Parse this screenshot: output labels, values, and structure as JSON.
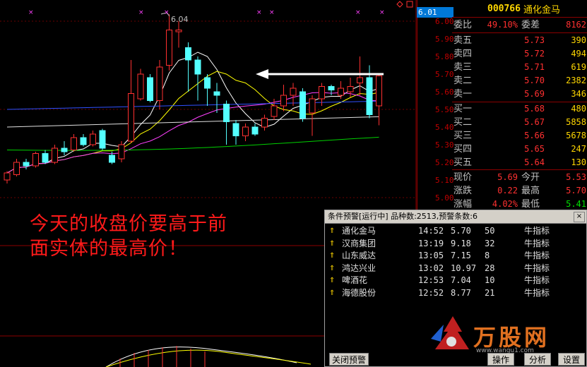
{
  "chart": {
    "high_label": "6.04",
    "current_price_box": "6.01",
    "price_ticks": [
      "6.00",
      "5.90",
      "5.80",
      "5.70",
      "5.60",
      "5.50",
      "5.40",
      "5.30",
      "5.20",
      "5.10",
      "5.00"
    ],
    "colors": {
      "up": "#ff3030",
      "down": "#54ffff",
      "ma5": "#ffffff",
      "ma10": "#ffff00",
      "ma20": "#ff40ff",
      "ma60": "#00d000",
      "ma_blue": "#3050ff"
    }
  },
  "annotation": {
    "line1": "今天的收盘价要高于前",
    "line2": "面实体的最高价！"
  },
  "quote": {
    "code": "000766",
    "name": "通化金马",
    "weibi_label": "委比",
    "weibi_value": "49.10%",
    "weicha_label": "委差",
    "weicha_value": "8162",
    "sell": [
      {
        "label": "卖五",
        "price": "5.73",
        "vol": "390"
      },
      {
        "label": "卖四",
        "price": "5.72",
        "vol": "494"
      },
      {
        "label": "卖三",
        "price": "5.71",
        "vol": "619"
      },
      {
        "label": "卖二",
        "price": "5.70",
        "vol": "2382"
      },
      {
        "label": "卖一",
        "price": "5.69",
        "vol": "346"
      }
    ],
    "buy": [
      {
        "label": "买一",
        "price": "5.68",
        "vol": "480"
      },
      {
        "label": "买二",
        "price": "5.67",
        "vol": "5858"
      },
      {
        "label": "买三",
        "price": "5.66",
        "vol": "5678"
      },
      {
        "label": "买四",
        "price": "5.65",
        "vol": "247"
      },
      {
        "label": "买五",
        "price": "5.64",
        "vol": "130"
      }
    ],
    "stats": [
      {
        "l1": "现价",
        "v1": "5.69",
        "l2": "今开",
        "v2": "5.53"
      },
      {
        "l1": "涨跌",
        "v1": "0.22",
        "l2": "最高",
        "v2": "5.70"
      },
      {
        "l1": "涨幅",
        "v1": "4.02%",
        "l2": "最低",
        "v2": "5.41"
      }
    ]
  },
  "alert": {
    "title": "条件预警[运行中] 品种数:2513,预警条数:6",
    "close": "×",
    "rows": [
      {
        "name": "通化金马",
        "time": "14:52",
        "price": "5.70",
        "count": "50",
        "indicator": "牛指标"
      },
      {
        "name": "汉商集团",
        "time": "13:19",
        "price": "9.18",
        "count": "32",
        "indicator": "牛指标"
      },
      {
        "name": "山东威达",
        "time": "13:05",
        "price": "7.15",
        "count": "8",
        "indicator": "牛指标"
      },
      {
        "name": "鸿达兴业",
        "time": "13:02",
        "price": "10.97",
        "count": "28",
        "indicator": "牛指标"
      },
      {
        "name": "啤酒花",
        "time": "12:53",
        "price": "7.04",
        "count": "10",
        "indicator": "牛指标"
      },
      {
        "name": "海德股份",
        "time": "12:52",
        "price": "8.77",
        "count": "21",
        "indicator": "牛指标"
      }
    ],
    "btn_close": "关闭预警",
    "btn_op": "操作",
    "btn_analyze": "分析",
    "btn_settings": "设置"
  },
  "watermark": {
    "brand": "万股网",
    "url": "www.wangu1.com"
  }
}
